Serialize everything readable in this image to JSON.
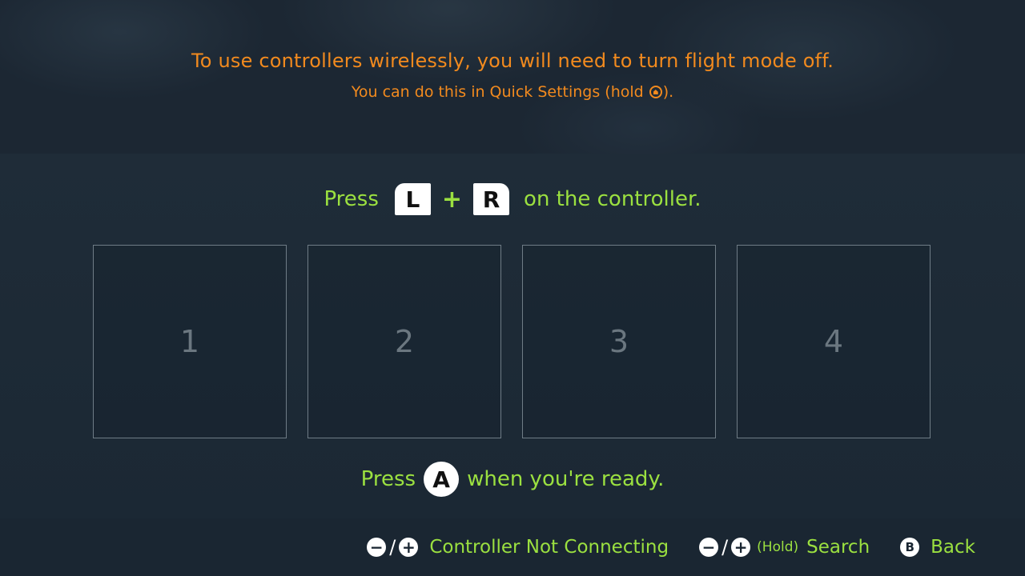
{
  "warning": {
    "main": "To use controllers wirelessly, you will need to turn flight mode off.",
    "sub_before": "You can do this in Quick Settings (hold ",
    "sub_icon": "home-button-icon",
    "sub_after": ")."
  },
  "instruction": {
    "press": "Press",
    "key_l": "L",
    "plus": "+",
    "key_r": "R",
    "suffix": "on the controller."
  },
  "slots": [
    {
      "number": "1"
    },
    {
      "number": "2"
    },
    {
      "number": "3"
    },
    {
      "number": "4"
    }
  ],
  "ready": {
    "press": "Press",
    "button": "A",
    "suffix": "when you're ready."
  },
  "footer": {
    "not_connecting": {
      "minus": "−",
      "slash": "/",
      "plus": "+",
      "label": "Controller Not Connecting"
    },
    "search": {
      "minus": "−",
      "slash": "/",
      "plus": "+",
      "hold": "(Hold)",
      "label": "Search"
    },
    "back": {
      "button": "B",
      "label": "Back"
    }
  },
  "colors": {
    "warning": "#f28a1e",
    "accent": "#9be040",
    "background": "#1a2733"
  }
}
